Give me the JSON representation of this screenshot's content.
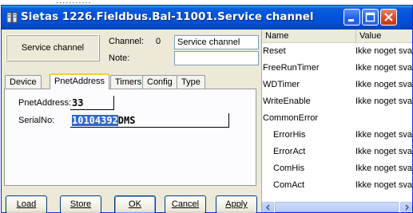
{
  "window": {
    "title": "Sietas 1226.Fieldbus.Bal-11001.Service channel",
    "bg_text": "..........."
  },
  "header": {
    "service_channel_label": "Service channel",
    "channel_label": "Channel:",
    "channel_number": "0",
    "channel_value": "Service channel",
    "note_label": "Note:",
    "note_value": ""
  },
  "tabs": [
    "Device",
    "PnetAddress",
    "Timers",
    "Config",
    "Type"
  ],
  "active_tab": "PnetAddress",
  "form": {
    "pnet_label": "PnetAddress:",
    "pnet_value": "33",
    "serial_label": "SerialNo:",
    "serial_selected": "10104392",
    "serial_rest": "DMS"
  },
  "buttons": {
    "load": "Load",
    "store": "Store",
    "ok": "OK",
    "cancel": "Cancel",
    "apply": "Apply"
  },
  "table": {
    "columns": [
      "Name",
      "Value"
    ],
    "rows": [
      {
        "name": "Reset",
        "value": "Ikke noget svar"
      },
      {
        "name": "FreeRunTimer",
        "value": "Ikke noget svar"
      },
      {
        "name": "WDTimer",
        "value": "Ikke noget svar"
      },
      {
        "name": "WriteEnable",
        "value": "Ikke noget svar"
      },
      {
        "name": "CommonError",
        "value": ""
      },
      {
        "name": "ErrorHis",
        "value": "Ikke noget svar"
      },
      {
        "name": "ErrorAct",
        "value": "Ikke noget svar"
      },
      {
        "name": "ComHis",
        "value": "Ikke noget svar"
      },
      {
        "name": "ComAct",
        "value": "Ikke noget svar"
      }
    ]
  },
  "colors": {
    "titlebar": "#0453de",
    "selection": "#316ac5",
    "dialog_bg": "#ece9d8"
  }
}
